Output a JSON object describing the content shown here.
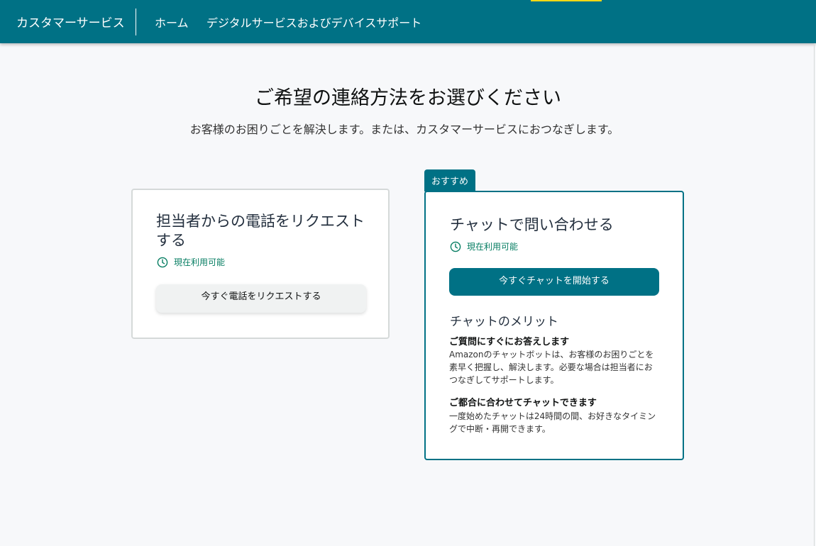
{
  "header": {
    "brand": "カスタマーサービス",
    "nav": [
      {
        "label": "ホーム"
      },
      {
        "label": "デジタルサービスおよびデバイスサポート"
      }
    ]
  },
  "main": {
    "title": "ご希望の連絡方法をお選びください",
    "subtitle": "お客様のお困りごとを解決します。または、カスタマーサービスにおつなぎします。"
  },
  "phone_card": {
    "title": "担当者からの電話をリクエストする",
    "status": "現在利用可能",
    "button_label": "今すぐ電話をリクエストする"
  },
  "chat_card": {
    "badge": "おすすめ",
    "title": "チャットで問い合わせる",
    "status": "現在利用可能",
    "button_label": "今すぐチャットを開始する",
    "benefits_heading": "チャットのメリット",
    "benefits": [
      {
        "title": "ご質問にすぐにお答えします",
        "text": "Amazonのチャットボットは、お客様のお困りごとを素早く把握し、解決します。必要な場合は担当者におつなぎしてサポートします。"
      },
      {
        "title": "ご都合に合わせてチャットできます",
        "text": "一度始めたチャットは24時間の間、お好きなタイミングで中断・再開できます。"
      }
    ]
  },
  "icons": {
    "status": "clock-icon"
  },
  "colors": {
    "header_bg": "#007185",
    "accent": "#ffd814",
    "status_green": "#067d62",
    "primary_button": "#007185",
    "secondary_button": "#f0f2f2"
  }
}
